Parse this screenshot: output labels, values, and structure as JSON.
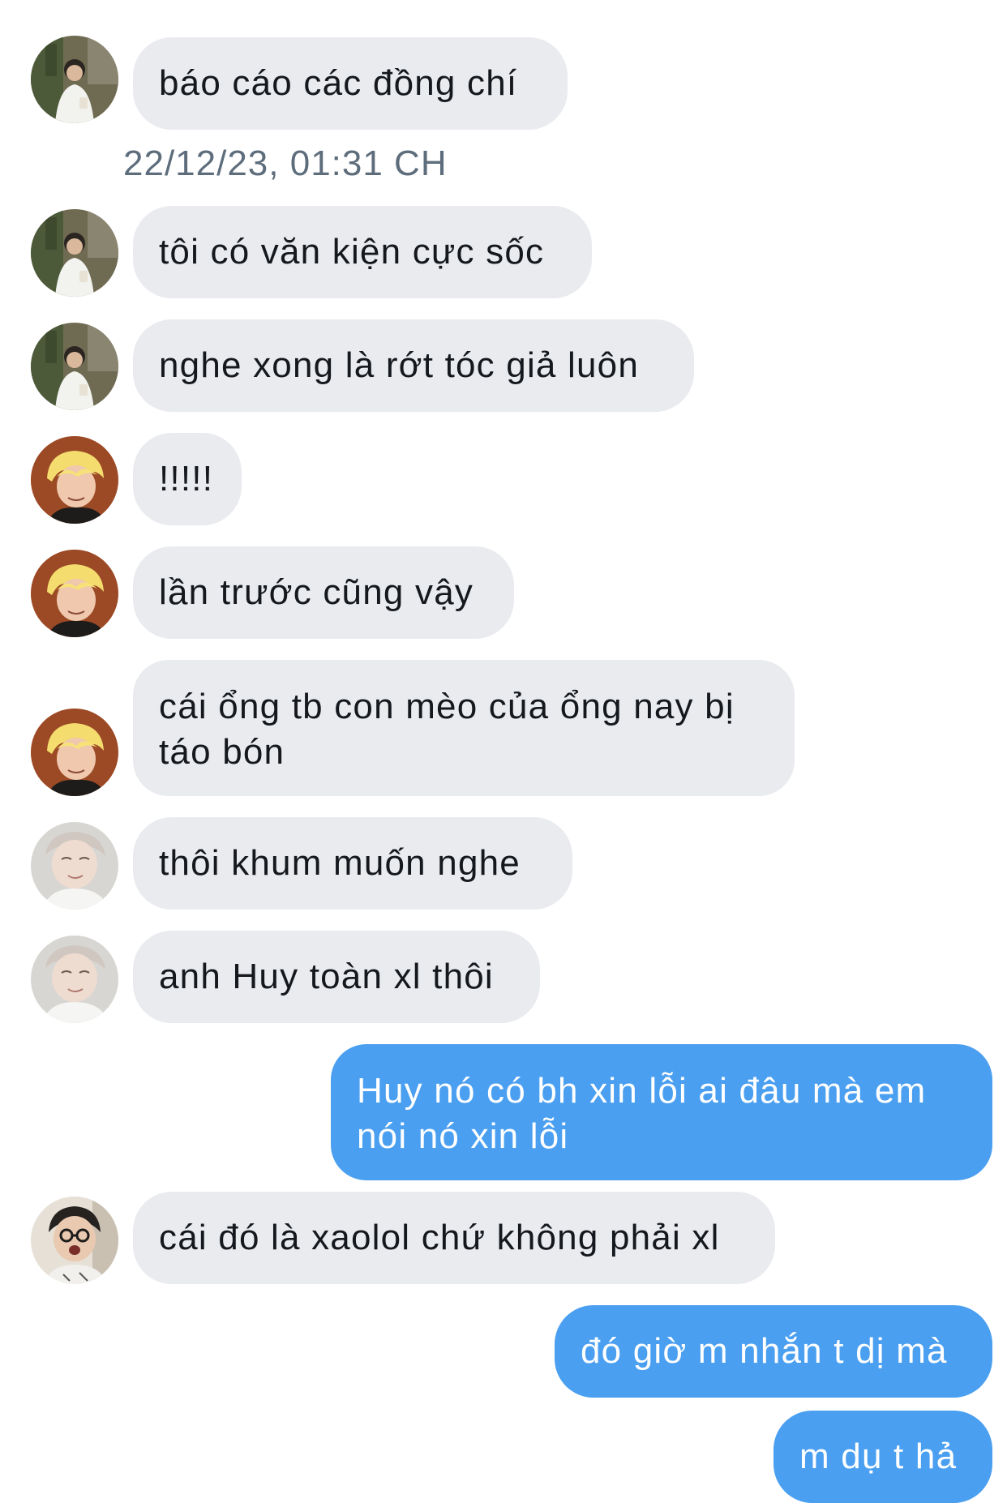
{
  "conversation": {
    "timestamp": "22/12/23, 01:31 CH",
    "messages": [
      {
        "side": "in",
        "sender": "user-a",
        "text": "báo cáo các đồng chí"
      },
      {
        "side": "in",
        "sender": "user-a",
        "text": "tôi có văn kiện cực sốc"
      },
      {
        "side": "in",
        "sender": "user-a",
        "text": "nghe xong là rớt tóc giả luôn"
      },
      {
        "side": "in",
        "sender": "user-b",
        "text": "!!!!!"
      },
      {
        "side": "in",
        "sender": "user-b",
        "text": "lần trước cũng vậy"
      },
      {
        "side": "in",
        "sender": "user-b",
        "text": "cái ổng tb con mèo của ổng nay bị táo bón"
      },
      {
        "side": "in",
        "sender": "user-c",
        "text": "thôi khum muốn nghe"
      },
      {
        "side": "in",
        "sender": "user-c",
        "text": "anh Huy toàn xl thôi"
      },
      {
        "side": "out",
        "sender": "me",
        "text": "Huy nó có bh xin lỗi ai đâu mà em nói nó xin lỗi"
      },
      {
        "side": "in",
        "sender": "user-d",
        "text": "cái đó là xaolol chứ không phải xl"
      },
      {
        "side": "out",
        "sender": "me",
        "text": "đó giờ m nhắn t dị mà"
      },
      {
        "side": "out",
        "sender": "me",
        "text": "m dụ t hả"
      }
    ]
  },
  "colors": {
    "incoming_bubble": "#e9ebef",
    "outgoing_bubble": "#4a9ff0",
    "timestamp_text": "#5e6d7c"
  }
}
